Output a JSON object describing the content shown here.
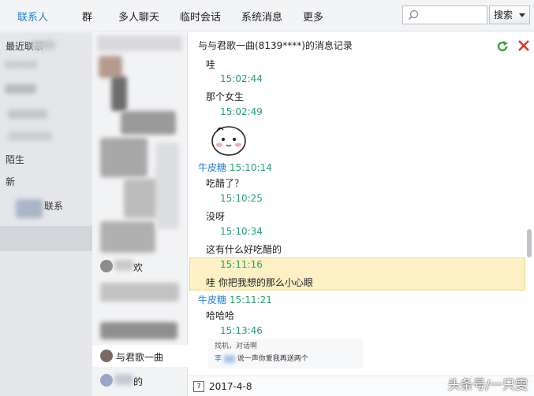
{
  "nav": {
    "tabs": [
      "联系人",
      "群",
      "多人聊天",
      "临时会话",
      "系统消息",
      "更多"
    ],
    "search_button": "搜索"
  },
  "left": {
    "items": [
      "最近联系",
      "陌生",
      "新",
      "联系"
    ]
  },
  "contacts": {
    "visible": [
      "欢",
      "与君歌一曲",
      "的"
    ]
  },
  "chat": {
    "title": "与与君歌一曲(8139****)的消息记录",
    "messages": [
      {
        "type": "text",
        "text": "哇"
      },
      {
        "type": "time",
        "text": "15:02:44"
      },
      {
        "type": "text",
        "text": "那个女生"
      },
      {
        "type": "time",
        "text": "15:02:49"
      },
      {
        "type": "sender",
        "name": "牛皮糖",
        "time": "15:10:14"
      },
      {
        "type": "text",
        "text": "吃醋了？"
      },
      {
        "type": "time",
        "text": "15:10:25"
      },
      {
        "type": "text",
        "text": "没呀"
      },
      {
        "type": "time",
        "text": "15:10:34"
      },
      {
        "type": "text",
        "text": "这有什么好吃醋的"
      },
      {
        "type": "time",
        "text": "15:11:16"
      },
      {
        "type": "text",
        "text": "哇 你把我想的那么小心眼"
      },
      {
        "type": "sender",
        "name": "牛皮糖",
        "time": "15:11:21"
      },
      {
        "type": "text",
        "text": "哈哈哈"
      },
      {
        "type": "time",
        "text": "15:13:46"
      }
    ],
    "quote": {
      "line1": "找机，对话啊",
      "name": "李",
      "line2": "说一声你爱我再送两个"
    },
    "date": "2017-4-8"
  },
  "watermark": "头条号/一只雯",
  "colors": {
    "accent": "#1f7fd0",
    "time": "#28a06e",
    "highlight": "#fdf0c5"
  }
}
